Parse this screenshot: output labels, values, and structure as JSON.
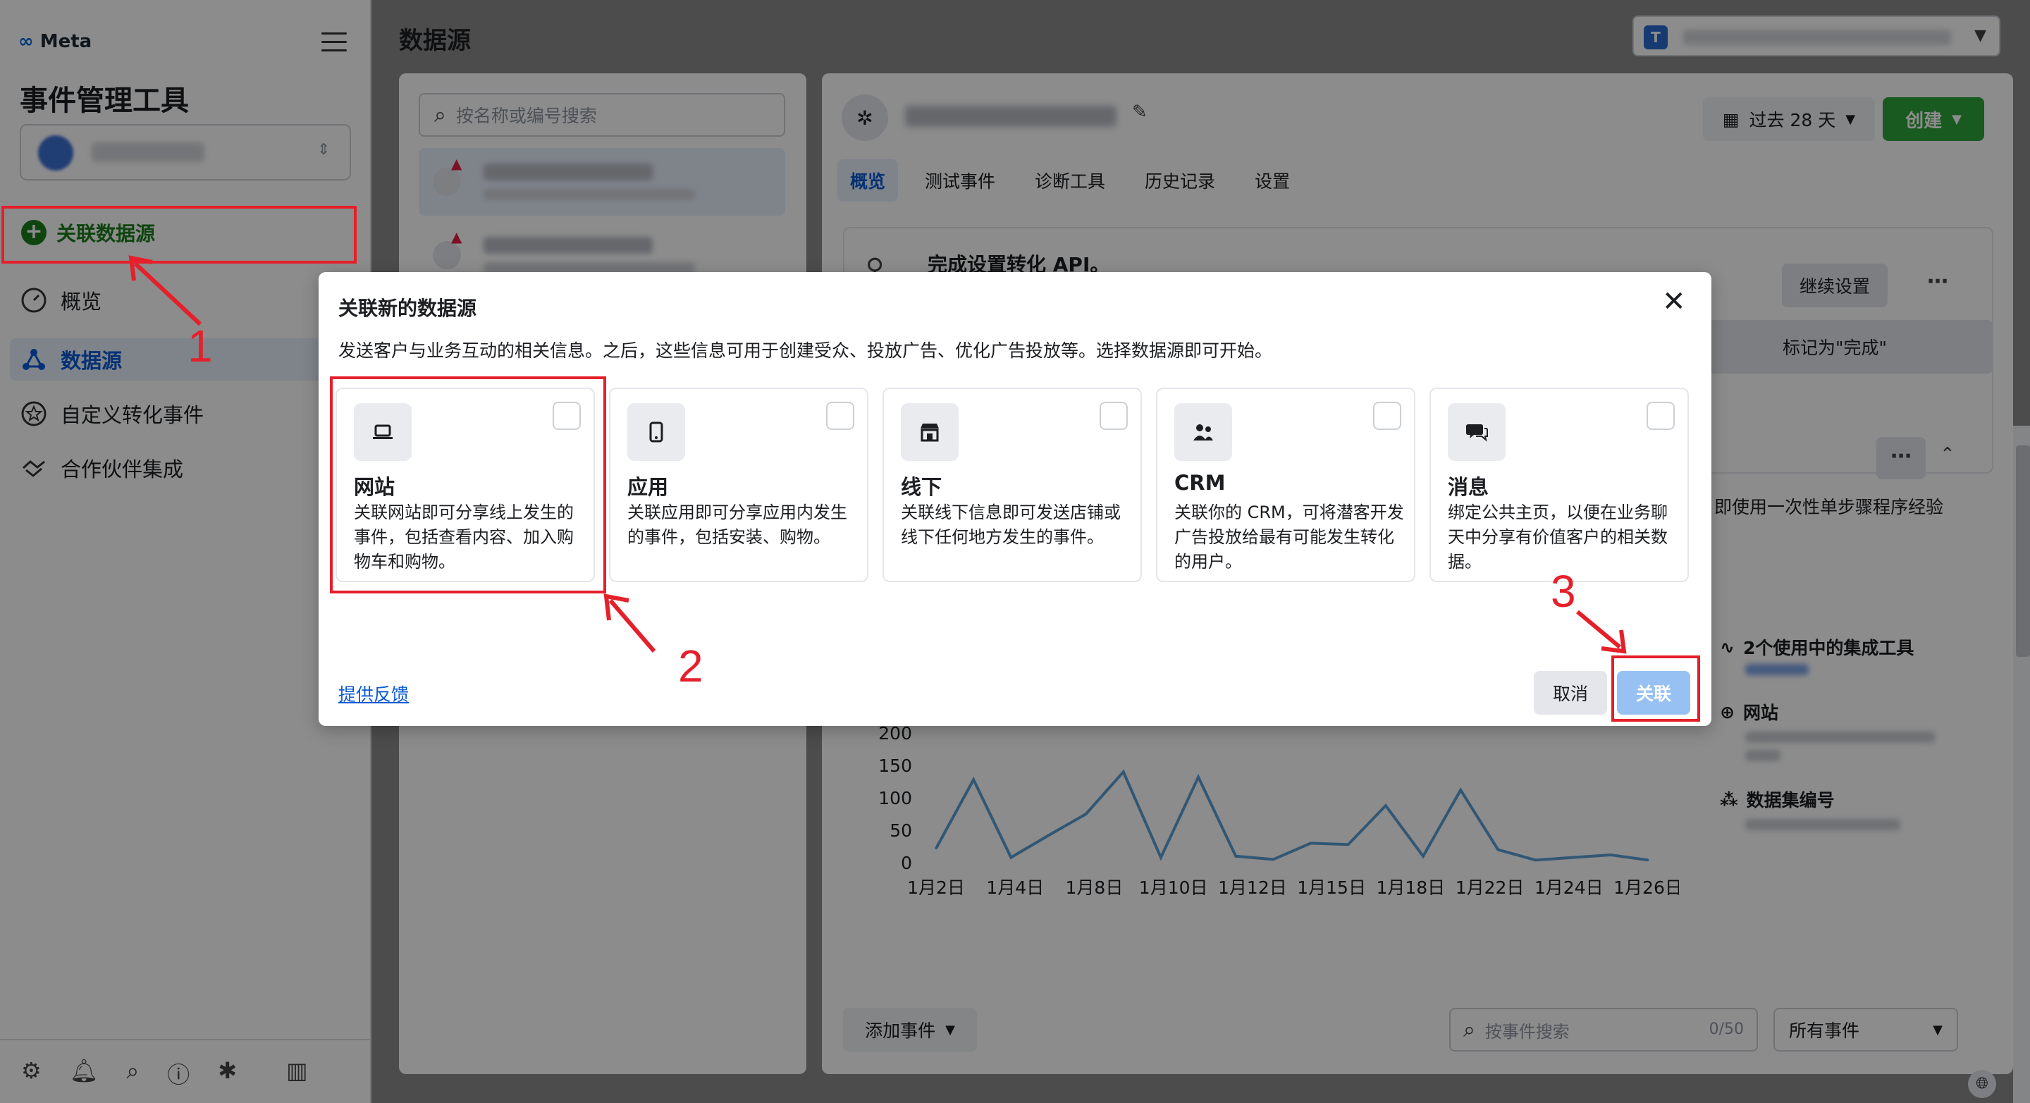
{
  "sidebar": {
    "brand": "Meta",
    "app_title": "事件管理工具",
    "connect_datasource": "关联数据源",
    "nav": [
      {
        "label": "概览",
        "icon": "gauge-icon"
      },
      {
        "label": "数据源",
        "icon": "datasource-icon"
      },
      {
        "label": "自定义转化事件",
        "icon": "star-icon"
      },
      {
        "label": "合作伙伴集成",
        "icon": "handshake-icon"
      }
    ],
    "bottom_icons": [
      "settings-icon",
      "bell-icon",
      "search-icon",
      "help-icon",
      "bug-icon",
      "panel-icon"
    ]
  },
  "main": {
    "page_title": "数据源",
    "account_initial": "T",
    "search_placeholder": "按名称或编号搜索",
    "date_range": "过去 28 天",
    "create_label": "创建",
    "tabs": [
      "概览",
      "测试事件",
      "诊断工具",
      "历史记录",
      "设置"
    ],
    "setup_title": "完成设置转化 API。",
    "done_partial": "完成",
    "continue_setup": "继续设置",
    "mark_done": "标记为\"完成\"",
    "side_text": "即使用一次性单步骤程序经验",
    "info_integrations": "2个使用中的集成工具",
    "info_website": "网站",
    "info_dataset_id": "数据集编号",
    "add_event": "添加事件",
    "event_search_placeholder": "按事件搜索",
    "event_search_count": "0/50",
    "all_events": "所有事件"
  },
  "chart_data": {
    "type": "line",
    "y_ticks": [
      "200",
      "150",
      "100",
      "50",
      "0"
    ],
    "ylim": [
      0,
      200
    ],
    "x_tick_labels": [
      "1月2日",
      "1月4日",
      "1月8日",
      "1月10日",
      "1月12日",
      "1月15日",
      "1月18日",
      "1月22日",
      "1月24日",
      "1月26日"
    ],
    "series": [
      {
        "values": [
          22,
          128,
          8,
          42,
          75,
          140,
          8,
          132,
          10,
          5,
          30,
          28,
          88,
          10,
          112,
          20,
          4,
          8,
          12,
          4
        ]
      }
    ],
    "color": "#5a9fd4"
  },
  "modal": {
    "title": "关联新的数据源",
    "description": "发送客户与业务互动的相关信息。之后，这些信息可用于创建受众、投放广告、优化广告投放等。选择数据源即可开始。",
    "options": [
      {
        "title": "网站",
        "desc": "关联网站即可分享线上发生的事件，包括查看内容、加入购物车和购物。",
        "icon": "laptop-icon"
      },
      {
        "title": "应用",
        "desc": "关联应用即可分享应用内发生的事件，包括安装、购物。",
        "icon": "phone-icon"
      },
      {
        "title": "线下",
        "desc": "关联线下信息即可发送店铺或线下任何地方发生的事件。",
        "icon": "store-icon"
      },
      {
        "title": "CRM",
        "desc": "关联你的 CRM，可将潜客开发广告投放给最有可能发生转化的用户。",
        "icon": "people-icon"
      },
      {
        "title": "消息",
        "desc": "绑定公共主页，以便在业务聊天中分享有价值客户的相关数据。",
        "icon": "chat-icon"
      }
    ],
    "feedback": "提供反馈",
    "cancel": "取消",
    "connect": "关联"
  },
  "annotations": [
    "1",
    "2",
    "3"
  ],
  "colors": {
    "annotation_red": "#e5202b",
    "brand_green": "#2da53a",
    "accent_blue": "#0a5ad4"
  }
}
